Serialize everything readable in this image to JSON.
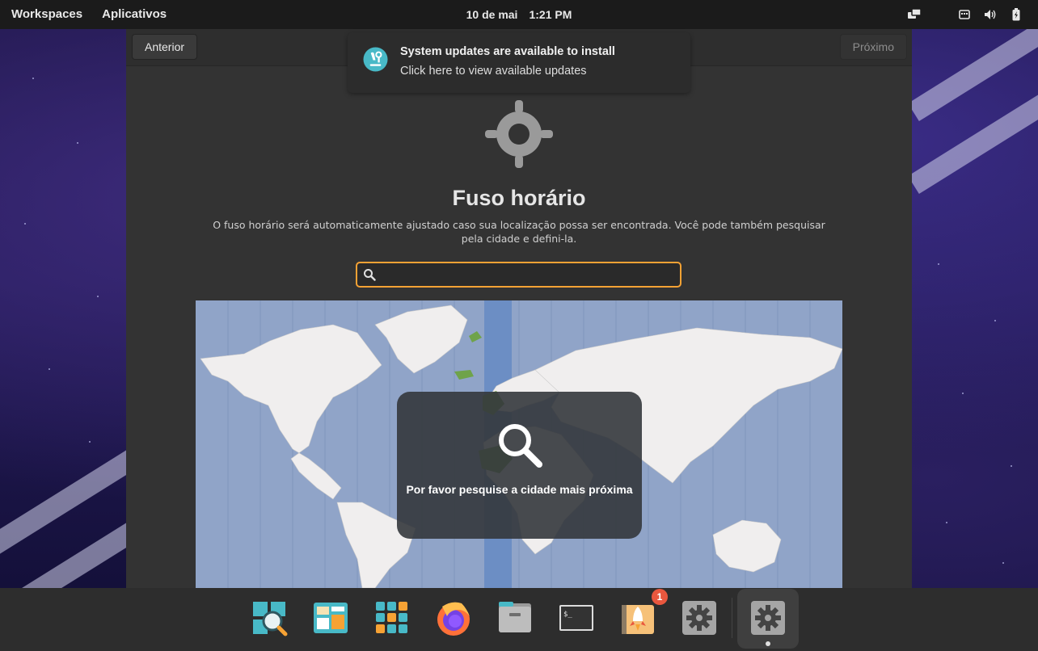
{
  "top_panel": {
    "workspaces_label": "Workspaces",
    "apps_label": "Aplicativos",
    "date": "10 de mai",
    "time": "1:21 PM"
  },
  "window": {
    "prev_label": "Anterior",
    "next_label": "Próximo",
    "title": "Fuso horário",
    "description": "O fuso horário será automaticamente ajustado caso sua localização possa ser encontrada. Você pode também pesquisar pela cidade e defini-la.",
    "search": {
      "value": "",
      "placeholder": ""
    },
    "map_overlay_text": "Por favor pesquise a cidade mais próxima"
  },
  "notification": {
    "title": "System updates are available to install",
    "body": "Click here to view available updates"
  },
  "dock": {
    "items": [
      {
        "icon": "system-monitor-search-icon"
      },
      {
        "icon": "workspaces-icon"
      },
      {
        "icon": "app-grid-icon"
      },
      {
        "icon": "firefox-icon"
      },
      {
        "icon": "files-icon"
      },
      {
        "icon": "terminal-icon"
      },
      {
        "icon": "pop-shop-icon",
        "badge": "1"
      },
      {
        "icon": "settings-icon"
      },
      {
        "icon": "settings-running-icon"
      }
    ]
  },
  "colors": {
    "accent": "#f6a234",
    "panel": "#1b1b1b",
    "window_bg": "#333333",
    "map_water": "#90a4c8",
    "map_land": "#f0eeee",
    "selected_zone": "#6c8ec4",
    "highlight_land": "#6fa34a",
    "badge": "#e9573e"
  }
}
